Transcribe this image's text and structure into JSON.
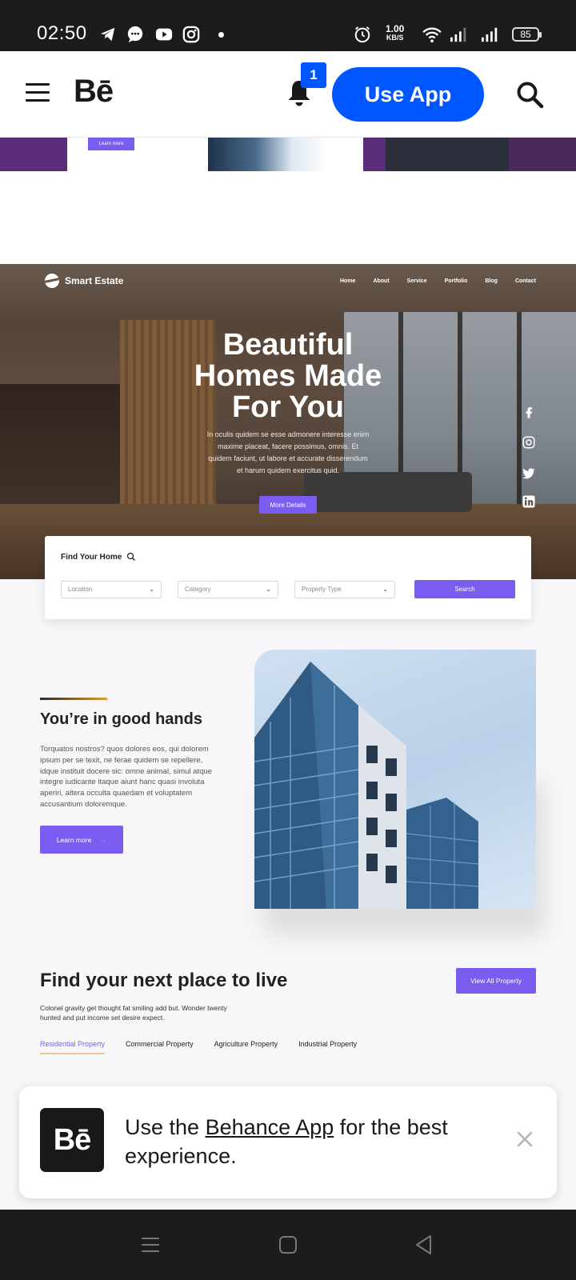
{
  "status_bar": {
    "time": "02:50",
    "net_speed_value": "1.00",
    "net_speed_unit": "KB/S",
    "battery": "85",
    "icons": [
      "telegram-icon",
      "messages-icon",
      "youtube-icon",
      "instagram-icon",
      "alarm-icon",
      "wifi-icon",
      "signal-icon",
      "signal-icon"
    ]
  },
  "header": {
    "logo": "Bē",
    "notification_count": "1",
    "use_app_label": "Use App"
  },
  "project": {
    "hero": {
      "brand": "Smart Estate",
      "nav": [
        "Home",
        "About",
        "Service",
        "Portfolio",
        "Blog",
        "Contact"
      ],
      "title_line1": "Beautiful",
      "title_line2": "Homes Made",
      "title_line3": "For You",
      "description": "In oculis quidem se esse admonere interesse enim maxime placeat, facere possimus, omnis. Et quidem faciunt, ut labore et accurate disserendum et harum quidem exercitus quid.",
      "button": "More Details"
    },
    "search": {
      "title": "Find Your Home",
      "location": "Location",
      "category": "Category",
      "property_type": "Property Type",
      "button": "Search"
    },
    "about": {
      "title": "You’re in good hands",
      "text": "Torquatos nostros? quos dolores eos, qui dolorem ipsum per se texit, ne ferae quidem se repellere, idque instituit docere sic: omne animal, simul atque integre iudicante itaque aiunt hanc quasi involuta aperiri, altera occulta quaedam et voluptatem accusantium doloremque.",
      "button": "Learn more",
      "button_arrow": "→"
    },
    "listings": {
      "title": "Find your next place to live",
      "subtitle": "Colonel gravity get thought fat smiling add but. Wonder twenty hunted and put income set desire expect.",
      "view_all": "View All Property",
      "tabs": [
        "Residential Property",
        "Commercial Property",
        "Agriculture Property",
        "Industrial Property"
      ]
    },
    "previous_strip": {
      "button": "Learn more"
    }
  },
  "app_banner": {
    "logo": "Bē",
    "text_before": "Use the ",
    "link": "Behance App",
    "text_after": " for the best experience."
  },
  "colors": {
    "behance_blue": "#0057ff",
    "accent_purple": "#7b5cf0",
    "dark": "#191919"
  }
}
